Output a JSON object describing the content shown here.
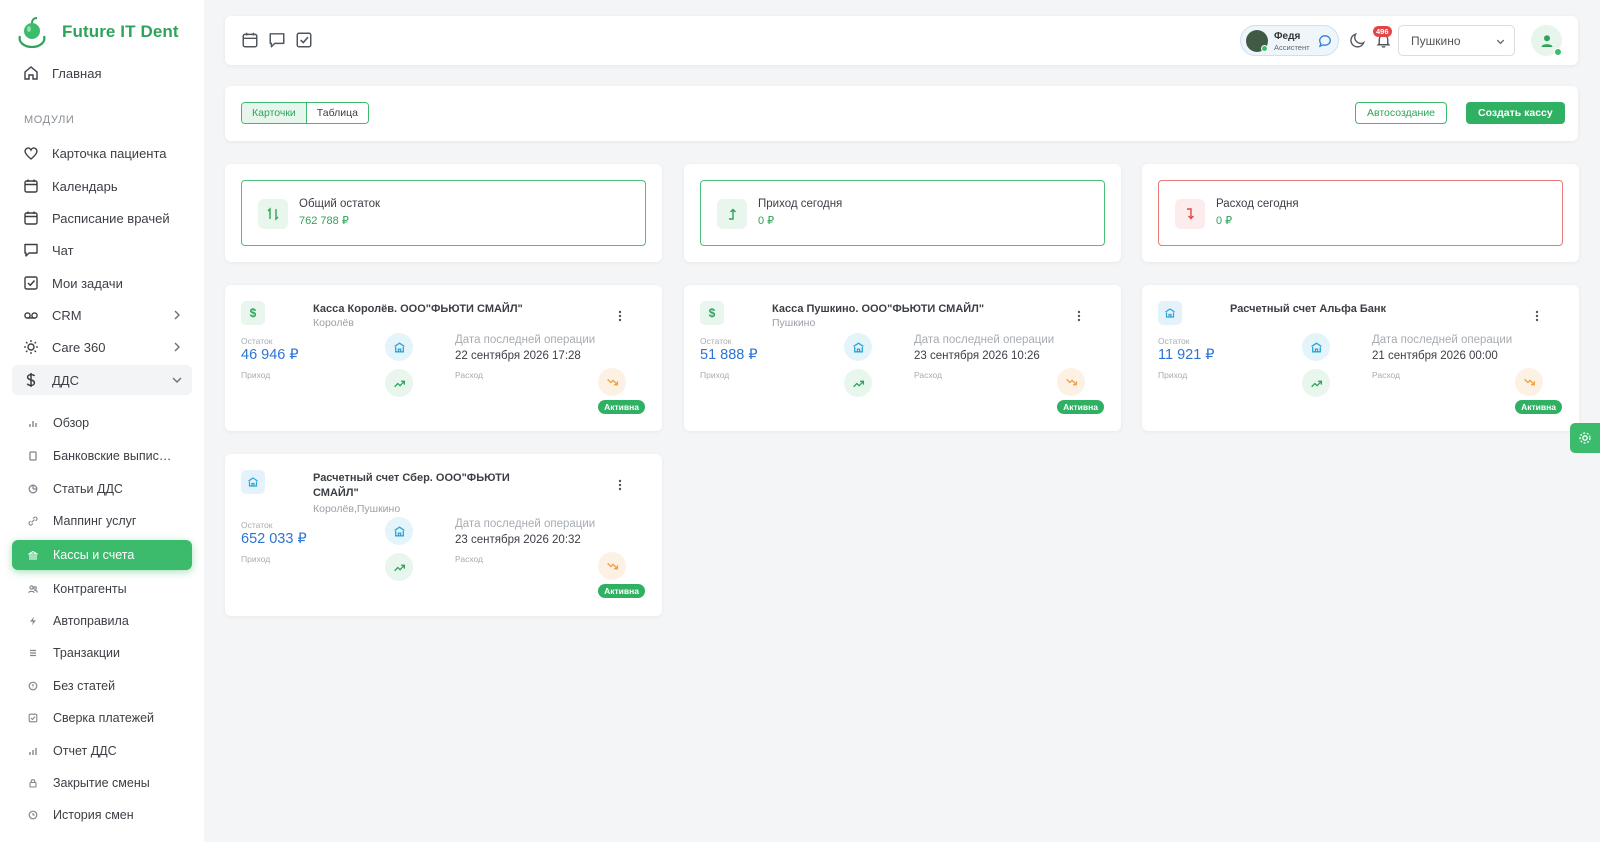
{
  "brand": {
    "name": "Future IT Dent"
  },
  "sidebar": {
    "home": "Главная",
    "section_label": "МОДУЛИ",
    "items": [
      {
        "label": "Карточка пациента",
        "icon": "heart-icon"
      },
      {
        "label": "Календарь",
        "icon": "calendar-icon"
      },
      {
        "label": "Расписание врачей",
        "icon": "calendar-icon"
      },
      {
        "label": "Чат",
        "icon": "chat-icon"
      },
      {
        "label": "Мои задачи",
        "icon": "checkbox-icon"
      },
      {
        "label": "CRM",
        "icon": "crm-icon"
      },
      {
        "label": "Care 360",
        "icon": "sun-icon"
      },
      {
        "label": "ДДС",
        "icon": "dollar-icon"
      }
    ],
    "sub_items": [
      {
        "label": "Обзор"
      },
      {
        "label": "Банковские выпис…"
      },
      {
        "label": "Статьи ДДС"
      },
      {
        "label": "Маппинг услуг"
      },
      {
        "label": "Кассы и счета"
      },
      {
        "label": "Контрагенты"
      },
      {
        "label": "Автоправила"
      },
      {
        "label": "Транзакции"
      },
      {
        "label": "Без статей"
      },
      {
        "label": "Сверка платежей"
      },
      {
        "label": "Отчет ДДС"
      },
      {
        "label": "Закрытие смены"
      },
      {
        "label": "История смен"
      }
    ]
  },
  "topbar": {
    "user_name": "Федя",
    "user_role": "Ассистент",
    "notifications": "496",
    "branch": "Пушкино"
  },
  "toolbar": {
    "view_cards": "Карточки",
    "view_table": "Таблица",
    "auto_create": "Автосоздание",
    "create_cash": "Создать кассу"
  },
  "summary": [
    {
      "title": "Общий остаток",
      "value": "762 788 ₽"
    },
    {
      "title": "Приход сегодня",
      "value": "0 ₽"
    },
    {
      "title": "Расход сегодня",
      "value": "0 ₽"
    }
  ],
  "labels": {
    "balance": "Остаток",
    "income": "Приход",
    "expense": "Расход",
    "last_op": "Дата последней операции",
    "status": "Активна"
  },
  "accounts": [
    {
      "title": "Касса Королёв. ООО\"ФЬЮТИ СМАЙЛ\"",
      "location": "Королёв",
      "amount": "46 946 ₽",
      "date": "22 сентября 2026 17:28"
    },
    {
      "title": "Касса Пушкино. ООО\"ФЬЮТИ СМАЙЛ\"",
      "location": "Пушкино",
      "amount": "51 888 ₽",
      "date": "23 сентября 2026 10:26"
    },
    {
      "title": "Расчетный счет Альфа Банк",
      "location": "",
      "amount": "11 921 ₽",
      "date": "21 сентября 2026 00:00"
    },
    {
      "title": "Расчетный счет Сбер. ООО\"ФЬЮТИ СМАЙЛ\"",
      "location": "Королёв,Пушкино",
      "amount": "652 033 ₽",
      "date": "23 сентября 2026 20:32"
    }
  ],
  "colors": {
    "accent": "#3dbb6c",
    "blue": "#2d74d6",
    "danger": "#e87a7a"
  }
}
